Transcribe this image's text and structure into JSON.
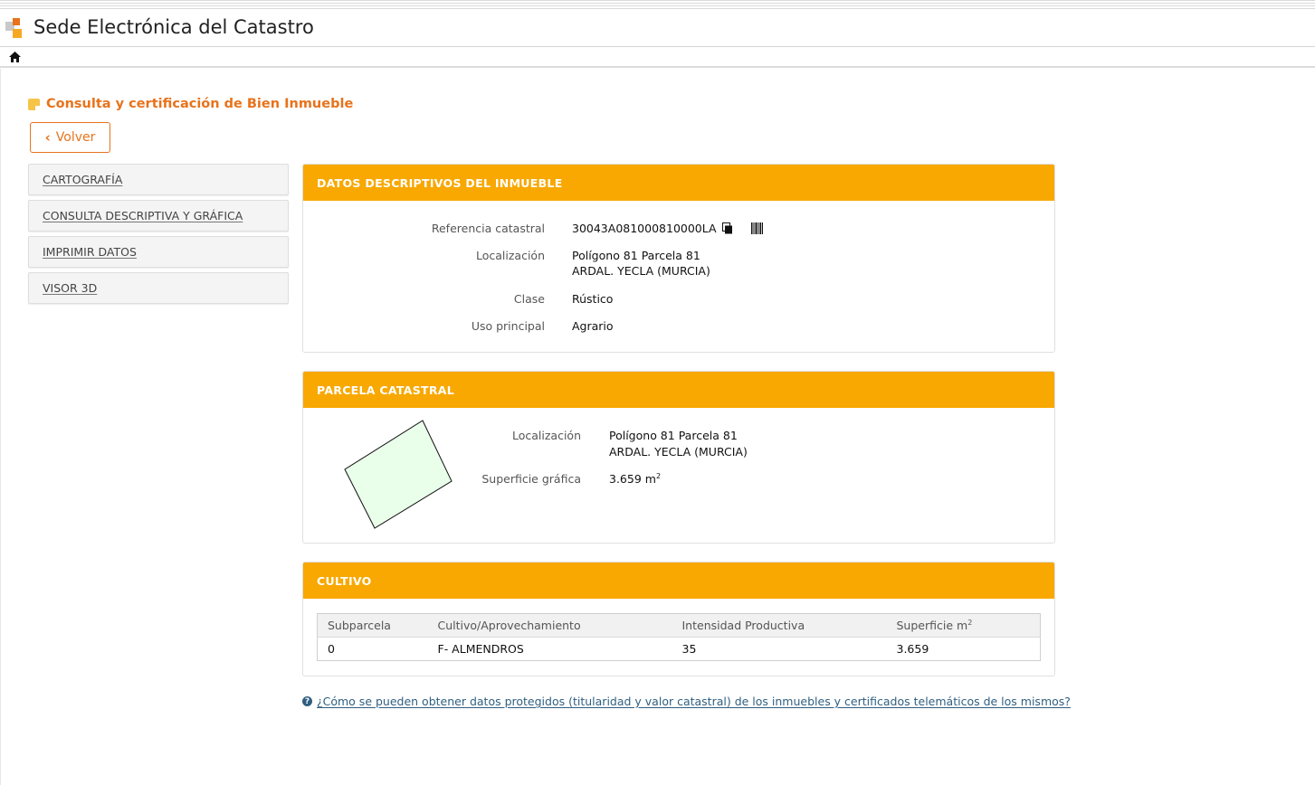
{
  "header": {
    "site_title": "Sede Electrónica del Catastro"
  },
  "page": {
    "heading": "Consulta y certificación de Bien Inmueble",
    "back_label": "Volver"
  },
  "sidebar": {
    "items": [
      {
        "label": "CARTOGRAFÍA"
      },
      {
        "label": "CONSULTA DESCRIPTIVA Y GRÁFICA"
      },
      {
        "label": "IMPRIMIR DATOS"
      },
      {
        "label": "VISOR 3D"
      }
    ]
  },
  "descriptivos": {
    "title": "DATOS DESCRIPTIVOS DEL INMUEBLE",
    "ref_label": "Referencia catastral",
    "ref_value": "30043A081000810000LA",
    "loc_label": "Localización",
    "loc_line1": "Polígono 81 Parcela 81",
    "loc_line2": "ARDAL. YECLA (MURCIA)",
    "clase_label": "Clase",
    "clase_value": "Rústico",
    "uso_label": "Uso principal",
    "uso_value": "Agrario"
  },
  "parcela": {
    "title": "PARCELA CATASTRAL",
    "loc_label": "Localización",
    "loc_line1": "Polígono 81 Parcela 81",
    "loc_line2": "ARDAL. YECLA (MURCIA)",
    "sup_label": "Superficie gráfica",
    "sup_value": "3.659",
    "sup_unit": "m",
    "sup_exp": "2"
  },
  "cultivo": {
    "title": "CULTIVO",
    "headers": {
      "subparcela": "Subparcela",
      "cultivo": "Cultivo/Aprovechamiento",
      "intensidad": "Intensidad Productiva",
      "superficie": "Superficie m",
      "superficie_exp": "2"
    },
    "rows": [
      {
        "subparcela": "0",
        "cultivo": "F- ALMENDROS",
        "intensidad": "35",
        "superficie": "3.659"
      }
    ]
  },
  "help": {
    "link_text": "¿Cómo se pueden obtener datos protegidos (titularidad y valor catastral) de los inmuebles y certificados telemáticos de los mismos?"
  },
  "colors": {
    "accent_orange": "#e8731c",
    "panel_header": "#f8a800",
    "parcel_fill": "#eaffea",
    "link": "#2f5f80"
  }
}
